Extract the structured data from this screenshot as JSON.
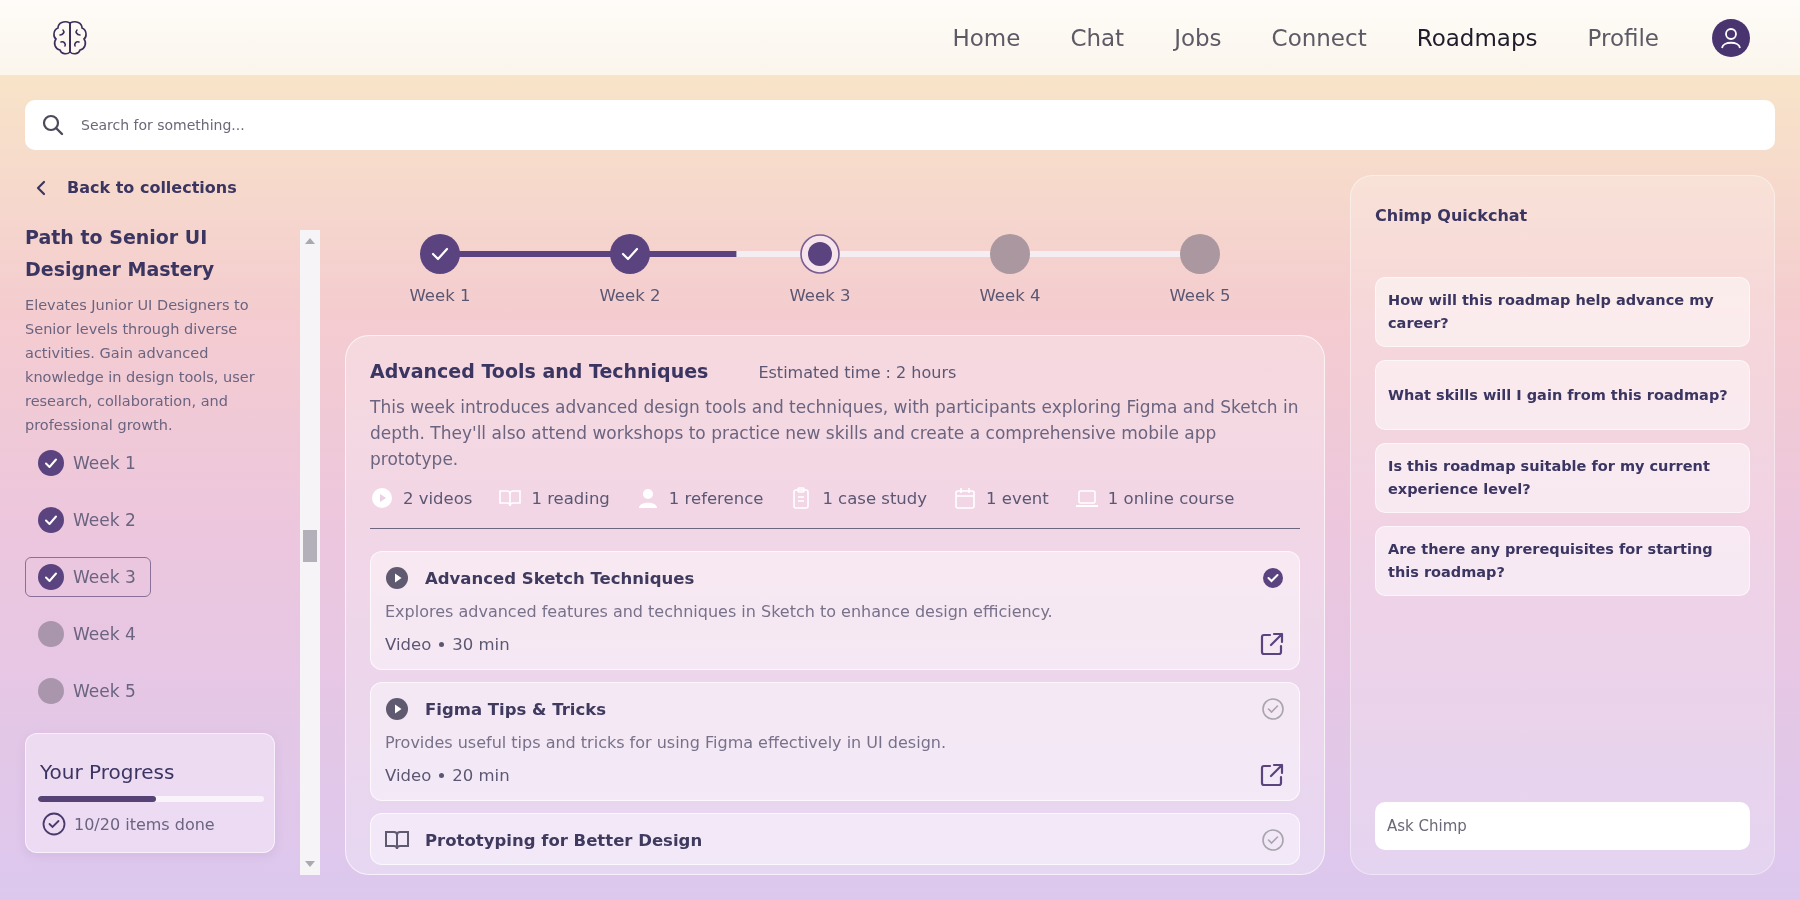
{
  "nav": {
    "links": [
      {
        "label": "Home",
        "selected": false
      },
      {
        "label": "Chat",
        "selected": false
      },
      {
        "label": "Jobs",
        "selected": false
      },
      {
        "label": "Connect",
        "selected": false
      },
      {
        "label": "Roadmaps",
        "selected": true
      },
      {
        "label": "Profile",
        "selected": false
      }
    ]
  },
  "search": {
    "placeholder": "Search for something..."
  },
  "back_link": "Back to collections",
  "roadmap": {
    "title": "Path to Senior UI Designer Mastery",
    "description": "Elevates Junior UI Designers to Senior levels through diverse activities. Gain advanced knowledge in design tools, user research, collaboration, and professional growth.",
    "weeks": [
      {
        "label": "Week 1",
        "checked": true,
        "selected": false
      },
      {
        "label": "Week 2",
        "checked": true,
        "selected": false
      },
      {
        "label": "Week 3",
        "checked": true,
        "selected": true
      },
      {
        "label": "Week 4",
        "checked": false,
        "selected": false
      },
      {
        "label": "Week 5",
        "checked": false,
        "selected": false
      }
    ]
  },
  "progress": {
    "title": "Your Progress",
    "level": 0.52,
    "text": "10/20 items done"
  },
  "timeline": {
    "level": 0.39,
    "steps": [
      {
        "label": "Week 1",
        "completed": true,
        "current": false
      },
      {
        "label": "Week 2",
        "completed": true,
        "current": false
      },
      {
        "label": "Week 3",
        "completed": false,
        "current": true
      },
      {
        "label": "Week 4",
        "completed": false,
        "current": false
      },
      {
        "label": "Week 5",
        "completed": false,
        "current": false
      }
    ]
  },
  "week_card": {
    "title": "Advanced Tools and Techniques",
    "estimate": "Estimated time : 2 hours",
    "description": "This week introduces advanced design tools and techniques, with participants exploring Figma and Sketch in depth. They'll also attend workshops to practice new skills and create a comprehensive mobile app prototype.",
    "resources": [
      {
        "kind": "video",
        "label": "2 videos"
      },
      {
        "kind": "reading",
        "label": "1 reading"
      },
      {
        "kind": "reference",
        "label": "1 reference"
      },
      {
        "kind": "case_study",
        "label": "1 case study"
      },
      {
        "kind": "event",
        "label": "1 event"
      },
      {
        "kind": "course",
        "label": "1 online course"
      }
    ],
    "items": [
      {
        "kind": "video",
        "title": "Advanced Sketch Techniques",
        "description": "Explores advanced features and techniques in Sketch to enhance design efficiency.",
        "type": "Video",
        "duration": "30 min",
        "completed": true
      },
      {
        "kind": "video",
        "title": "Figma Tips & Tricks",
        "description": "Provides useful tips and tricks for using Figma effectively in UI design.",
        "type": "Video",
        "duration": "20 min",
        "completed": false
      },
      {
        "kind": "reading",
        "title": "Prototyping for Better Design",
        "completed": false
      }
    ]
  },
  "chat": {
    "title": "Chimp Quickchat",
    "suggestions": [
      "How will this roadmap help advance my career?",
      "What skills will I gain from this roadmap?",
      "Is this roadmap suitable for my current experience level?",
      "Are there any prerequisites for starting this roadmap?"
    ],
    "input_placeholder": "Ask Chimp"
  }
}
